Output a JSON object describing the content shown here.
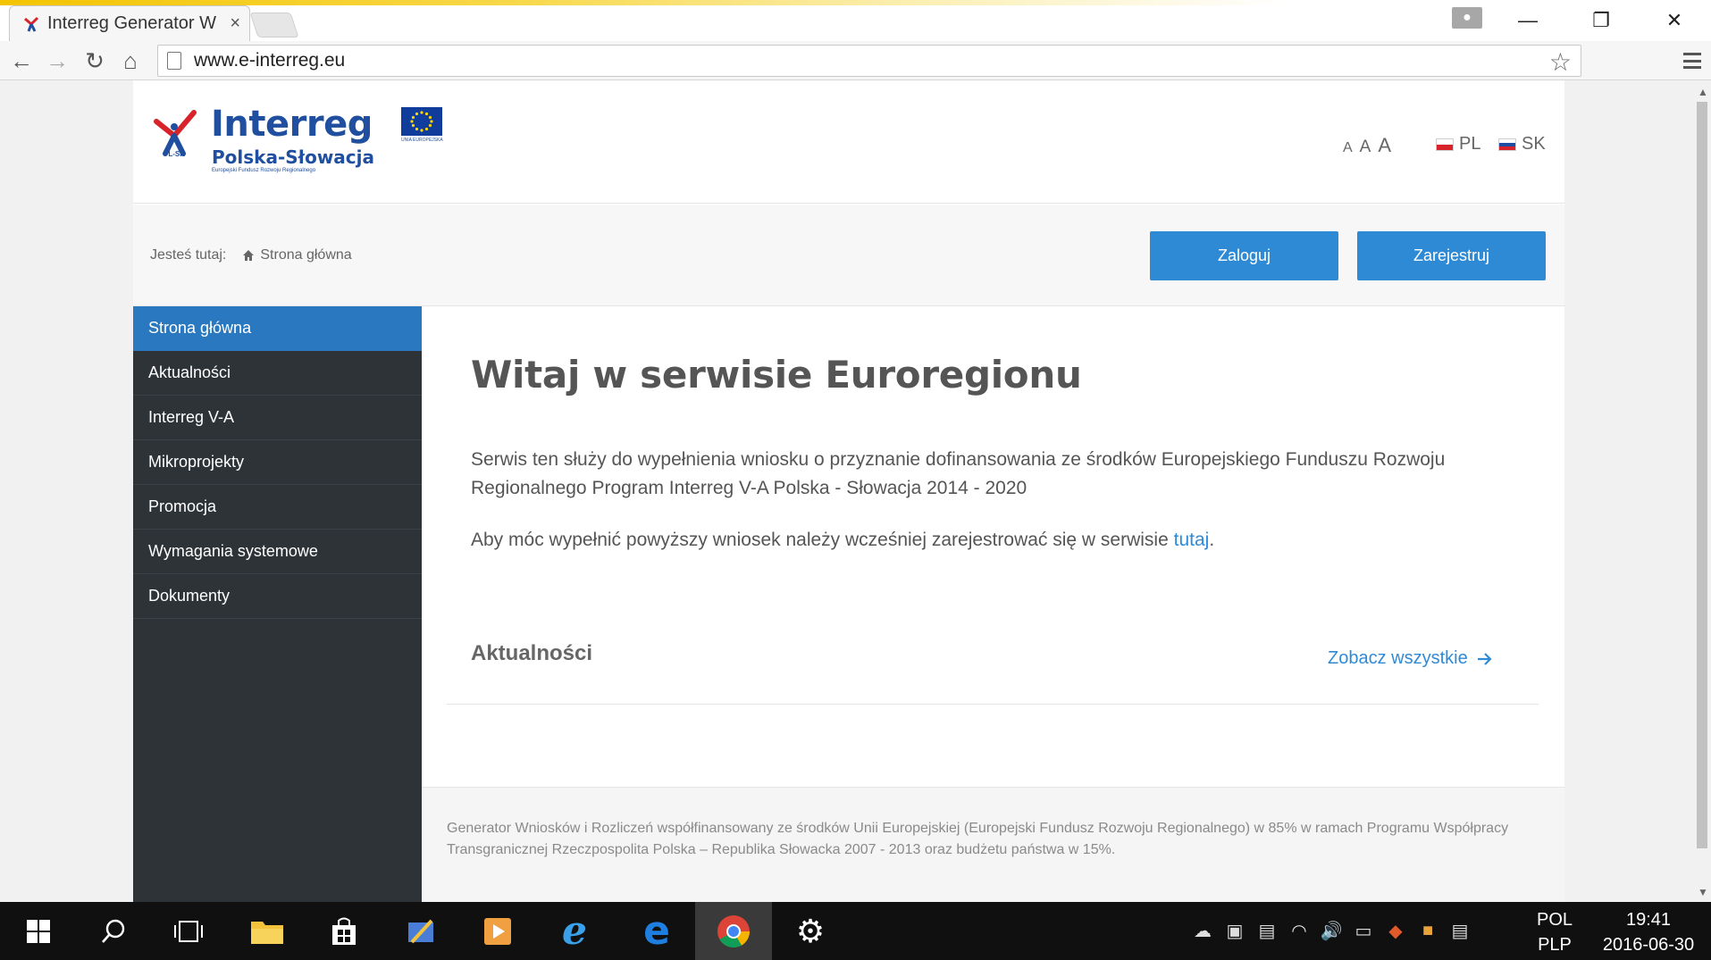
{
  "browser": {
    "tab_title": "Interreg Generator W",
    "tab_close": "×",
    "url": "www.e-interreg.eu",
    "window_controls": {
      "minimize": "—",
      "restore": "❐",
      "close": "✕"
    },
    "nav": {
      "back": "←",
      "forward": "→",
      "reload": "↻",
      "home": "⌂",
      "star": "☆"
    }
  },
  "header": {
    "logo": {
      "name": "Interreg",
      "program": "Polska-Słowacja",
      "tagline": "Europejski Fundusz Rozwoju Regionalnego",
      "region": "PL-SK",
      "eu_label": "UNIA EUROPEJSKA"
    },
    "font_sizes": [
      "A",
      "A",
      "A"
    ],
    "languages": [
      {
        "code": "PL",
        "flag": "flag-poland"
      },
      {
        "code": "SK",
        "flag": "flag-slovakia"
      }
    ]
  },
  "bar": {
    "breadcrumb_prefix": "Jesteś tutaj:",
    "breadcrumb_current": "Strona główna",
    "login_label": "Zaloguj",
    "register_label": "Zarejestruj"
  },
  "sidebar": {
    "items": [
      {
        "label": "Strona główna",
        "active": true
      },
      {
        "label": "Aktualności"
      },
      {
        "label": "Interreg V-A"
      },
      {
        "label": "Mikroprojekty"
      },
      {
        "label": "Promocja"
      },
      {
        "label": "Wymagania systemowe"
      },
      {
        "label": "Dokumenty"
      }
    ]
  },
  "main": {
    "title": "Witaj w serwisie Euroregionu",
    "intro": "Serwis ten służy do wypełnienia wniosku o przyznanie dofinansowania ze środków Europejskiego Funduszu Rozwoju Regionalnego Program Interreg V-A Polska - Słowacja 2014 - 2020",
    "register_prefix": "Aby móc wypełnić powyższy wniosek należy wcześniej zarejestrować się w serwisie ",
    "register_link": "tutaj",
    "register_suffix": ".",
    "news_title": "Aktualności",
    "see_all": "Zobacz wszystkie"
  },
  "footer": {
    "text": "Generator Wniosków i Rozliczeń współfinansowany ze środków Unii Europejskiej (Europejski Fundusz Rozwoju Regionalnego) w 85% w ramach Programu Współpracy Transgranicznej Rzeczpospolita Polska – Republika Słowacka 2007 - 2013 oraz budżetu państwa w 15%."
  },
  "taskbar": {
    "language_top": "POL",
    "language_bottom": "PLP",
    "time": "19:41",
    "date": "2016-06-30"
  },
  "colors": {
    "accent": "#2f8ad6",
    "sidebar_bg": "#2e3338",
    "sidebar_active": "#2a79c0",
    "logo_blue": "#1f4f9e"
  }
}
